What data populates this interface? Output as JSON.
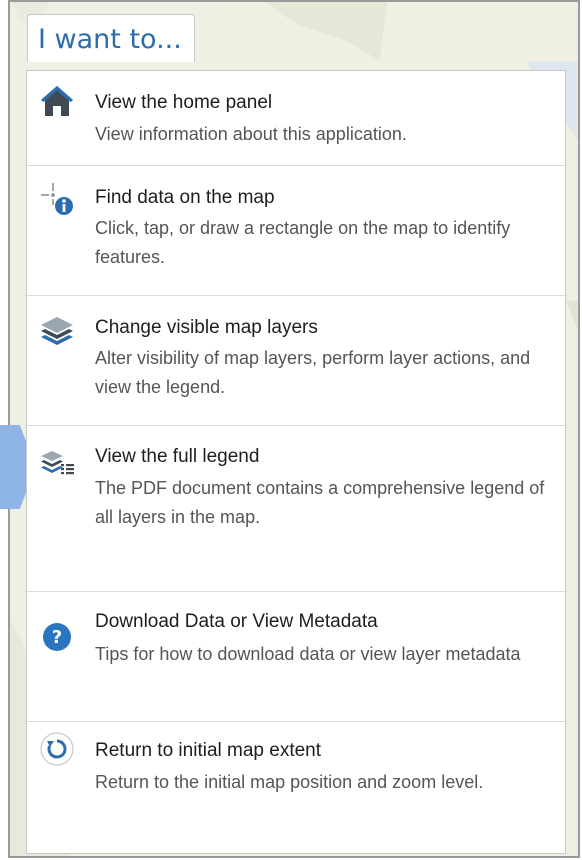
{
  "tab_label": "I want to...",
  "colors": {
    "accent": "#2c6db0",
    "arrow": "#8fb4e6",
    "icon_gray": "#3f4a55",
    "help_blue": "#2a75bf"
  },
  "menu": {
    "items": [
      {
        "title": "View the home panel",
        "description": "View information about this application.",
        "icon": "home-icon"
      },
      {
        "title": "Find data on the map",
        "description": "Click, tap, or draw a rectangle on the map to identify features.",
        "icon": "identify-info-icon"
      },
      {
        "title": "Change visible map layers",
        "description": "Alter visibility of map layers, perform layer actions, and view the legend.",
        "icon": "layers-icon"
      },
      {
        "title": "View the full legend",
        "description": "The PDF document contains a comprehensive legend of all layers in the map.",
        "icon": "legend-icon"
      },
      {
        "title": "Download Data or View Metadata",
        "description": "Tips for how to download data or view layer metadata",
        "icon": "help-question-icon"
      },
      {
        "title": "Return to initial map extent",
        "description": "Return to the initial map position and zoom level.",
        "icon": "reset-extent-icon"
      }
    ]
  }
}
